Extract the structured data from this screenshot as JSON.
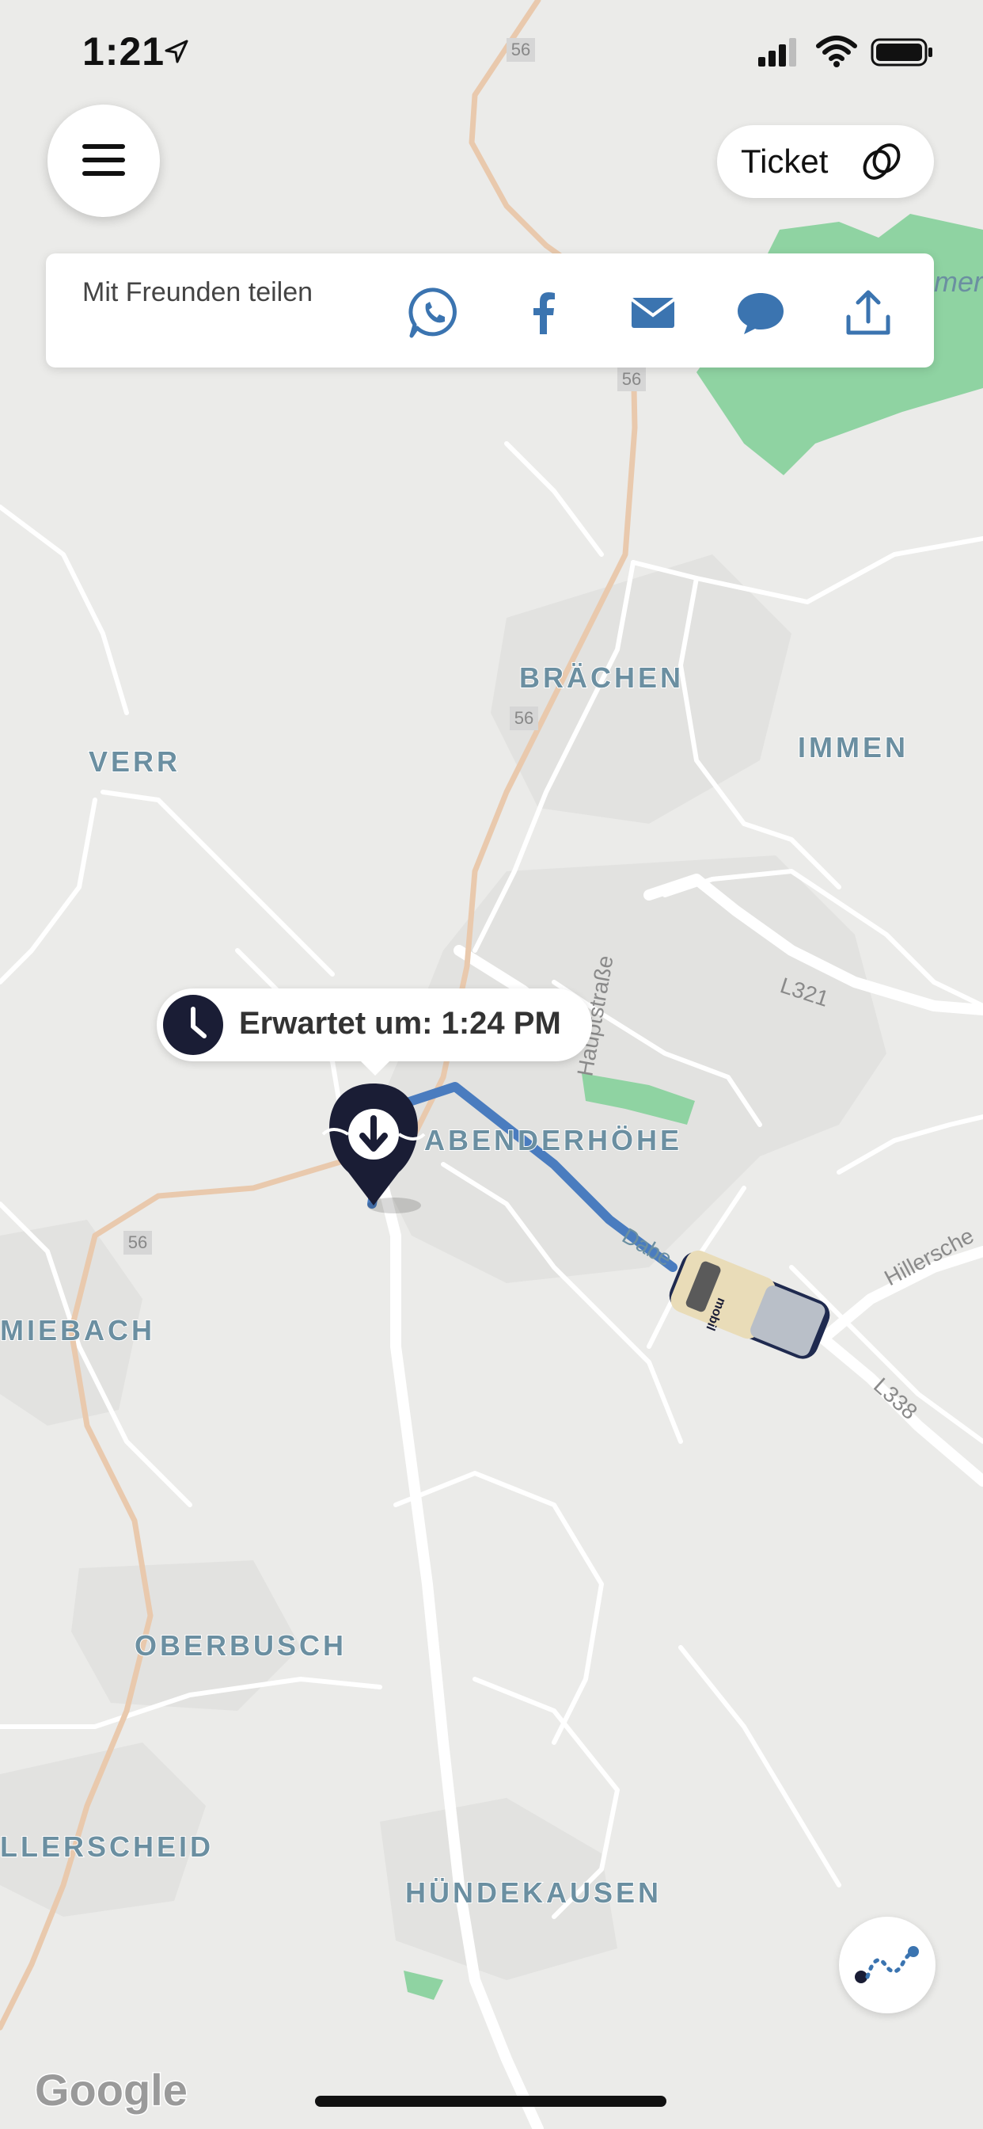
{
  "status_bar": {
    "time": "1:21",
    "icons": [
      "location-arrow-icon",
      "cellular-signal-icon",
      "wifi-icon",
      "battery-icon"
    ]
  },
  "header": {
    "menu_icon": "hamburger-menu-icon",
    "ticket_label": "Ticket",
    "ticket_icon": "ticket-rings-icon"
  },
  "share": {
    "label": "Mit Freunden teilen",
    "buttons": [
      {
        "name": "whatsapp",
        "icon": "whatsapp-icon"
      },
      {
        "name": "facebook",
        "icon": "facebook-icon"
      },
      {
        "name": "email",
        "icon": "mail-icon"
      },
      {
        "name": "message",
        "icon": "chat-bubble-icon"
      },
      {
        "name": "share",
        "icon": "share-upload-icon"
      }
    ]
  },
  "eta": {
    "text": "Erwartet um: 1:24 PM",
    "icon": "clock-icon"
  },
  "map": {
    "places": {
      "braechen": "BRÄCHEN",
      "immen": "IMMEN",
      "verr": "VERR",
      "abenderhoehe": "ABENDERHÖHE",
      "miebach": "MIEBACH",
      "oberbusch": "OBERBUSCH",
      "llerscheid": "LLERSCHEID",
      "huendekausen": "HÜNDEKAUSEN"
    },
    "roads": {
      "r56_a": "56",
      "r56_b": "56",
      "r56_c": "56",
      "r56_d": "56",
      "l321": "L321",
      "l338": "L338",
      "hillerscheid": "Hillersche",
      "hauptstrasse": "Hauptstraße",
      "dabe": "Dabe",
      "immen_edge": "mer"
    },
    "vehicle_label": "mobil",
    "dropoff_icon": "dropoff-pin-icon",
    "vehicle_icon": "shuttle-van-icon",
    "attribution": "Google"
  },
  "route_button_icon": "route-path-icon",
  "colors": {
    "accent": "#3b74b0",
    "pin": "#1a1d35",
    "route": "#4a7cbf",
    "map_bg": "#ebebe9",
    "major_road": "#e9c9ad",
    "park": "#8fd3a2",
    "place_label": "#6b8fa1"
  }
}
